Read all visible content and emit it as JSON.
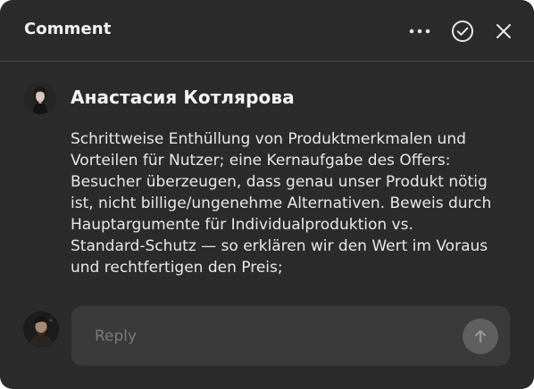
{
  "header": {
    "title": "Comment",
    "icons": [
      "more-icon",
      "check-circle-icon",
      "close-icon"
    ]
  },
  "comment": {
    "author": "Анастасия Котлярова",
    "body_lines": [
      "Schrittweise Enthüllung von Produktmerkmalen und",
      "Vorteilen für Nutzer; eine Kernaufgabe des Offers:",
      "Besucher überzeugen, dass genau unser Produkt nötig",
      "ist, nicht billige/ungenehme Alternativen. Beweis durch",
      "Hauptargumente für Individualproduktion vs.",
      "Standard-Schutz — so erklären wir den Wert im Voraus",
      "und rechtfertigen den Preis;"
    ]
  },
  "reply": {
    "placeholder": "Reply",
    "value": "",
    "send_icon": "arrow-up-icon"
  },
  "colors": {
    "panel_bg": "#2b2b2b",
    "input_bg": "#3a3a3a",
    "send_button": "#5f5f5f",
    "text_primary": "#f2f2f2"
  }
}
